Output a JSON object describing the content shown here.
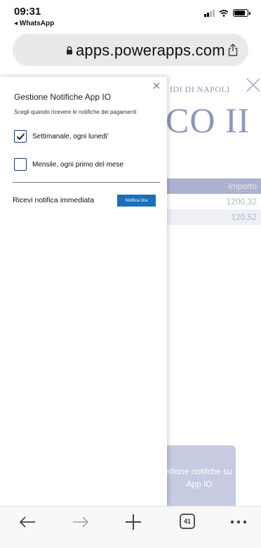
{
  "status_bar": {
    "time": "09:31",
    "back_app": "◂ WhatsApp",
    "battery_level": 0.85
  },
  "browser": {
    "url": "apps.powerapps.com",
    "lock_icon": "lock-icon",
    "share_icon": "share-icon",
    "toolbar": {
      "back_icon": "back-arrow-icon",
      "forward_icon": "forward-arrow-icon",
      "new_tab_icon": "plus-icon",
      "tab_count": "41",
      "more_icon": "more-dots-icon"
    }
  },
  "background_app": {
    "university_top": "IDI DI NAPOLI",
    "university_big": "CO II",
    "table_header": "Importo",
    "rows": [
      "1200,32",
      "120,52"
    ],
    "notif_button": "stione notifche su App IO"
  },
  "panel": {
    "title": "Gestione Notifiche App IO",
    "subtitle": "Scegli quando ricevere le notifiche dei pagamenti",
    "options": [
      {
        "label": "Settimanale, ogni lunedi'",
        "checked": true
      },
      {
        "label": "Mensile, ogni primo del mese",
        "checked": false
      }
    ],
    "immediate_label": "Ricevi notifica immediata",
    "notify_button": "Notifica Ora"
  },
  "colors": {
    "accent": "#1c6fb8",
    "checkbox_border": "#1b3a6b",
    "bg_text": "#8f97b8",
    "bg_table_head": "#aab2cf"
  }
}
